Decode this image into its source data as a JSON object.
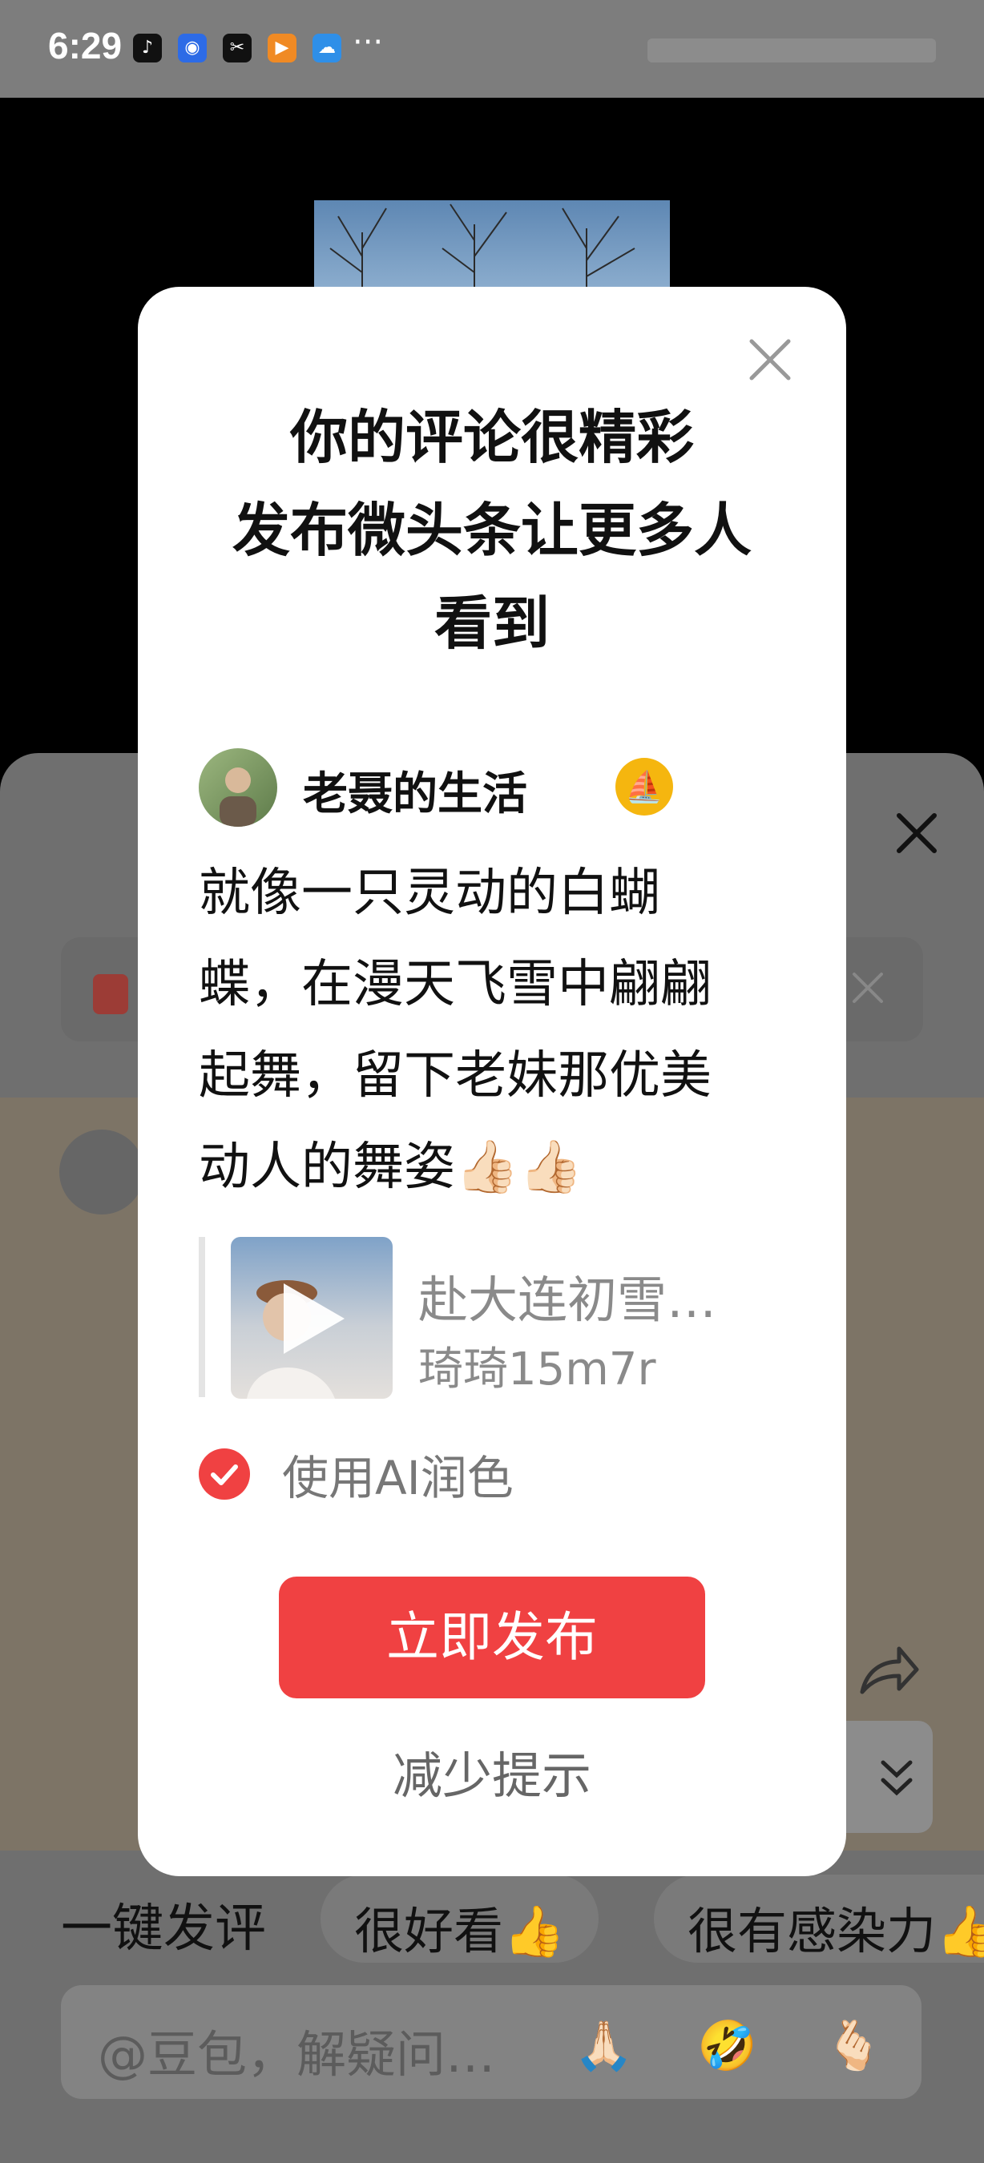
{
  "status_bar": {
    "time": "6:29",
    "app_icons": [
      "tiktok-icon",
      "bulb-icon",
      "capcut-icon",
      "play-icon",
      "weather-icon"
    ],
    "overflow": "···"
  },
  "dialog": {
    "title_lines": [
      "你的评论很精彩",
      "发布微头条让更多人",
      "看到"
    ],
    "author_name": "老聂的生活",
    "comment_lines": [
      "就像一只灵动的白蝴",
      "蝶，在漫天飞雪中翩翩",
      "起舞，留下老妹那优美",
      "动人的舞姿👍🏻👍🏻"
    ],
    "quoted_title": "赴大连初雪…",
    "quoted_user": "琦琦15m7r",
    "ai_polish_label": "使用AI润色",
    "ai_polish_checked": true,
    "publish_label": "立即发布",
    "reduce_label": "减少提示",
    "accent_color": "#f04142"
  },
  "background": {
    "quick_comment_label": "一键发评",
    "quick_chips": [
      "很好看👍",
      "很有感染力👍"
    ],
    "input_placeholder": "@豆包，解疑问…",
    "input_emojis": [
      "🙏🏻",
      "🤣",
      "🫰🏻"
    ]
  }
}
